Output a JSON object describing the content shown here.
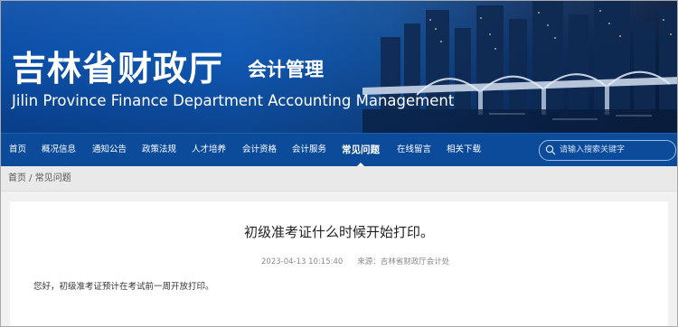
{
  "header": {
    "title_cn": "吉林省财政厅",
    "subtitle_cn": "会计管理",
    "title_en": "Jilin Province Finance Department Accounting Management"
  },
  "nav": {
    "items": [
      {
        "label": "首页"
      },
      {
        "label": "概况信息"
      },
      {
        "label": "通知公告"
      },
      {
        "label": "政策法规"
      },
      {
        "label": "人才培养"
      },
      {
        "label": "会计资格"
      },
      {
        "label": "会计服务"
      },
      {
        "label": "常见问题",
        "active": true
      },
      {
        "label": "在线留言"
      },
      {
        "label": "相关下载"
      }
    ],
    "search": {
      "placeholder": "请输入搜索关键字",
      "icon": "search-icon"
    }
  },
  "breadcrumb": {
    "home": "首页",
    "separator": " / ",
    "current": "常见问题"
  },
  "article": {
    "title": "初级准考证什么时候开始打印。",
    "date": "2023-04-13 10:15:40",
    "source_label": "来源：",
    "source": "吉林省财政厅会计处",
    "body": "您好，初级准考证预计在考试前一周开放打印。"
  }
}
